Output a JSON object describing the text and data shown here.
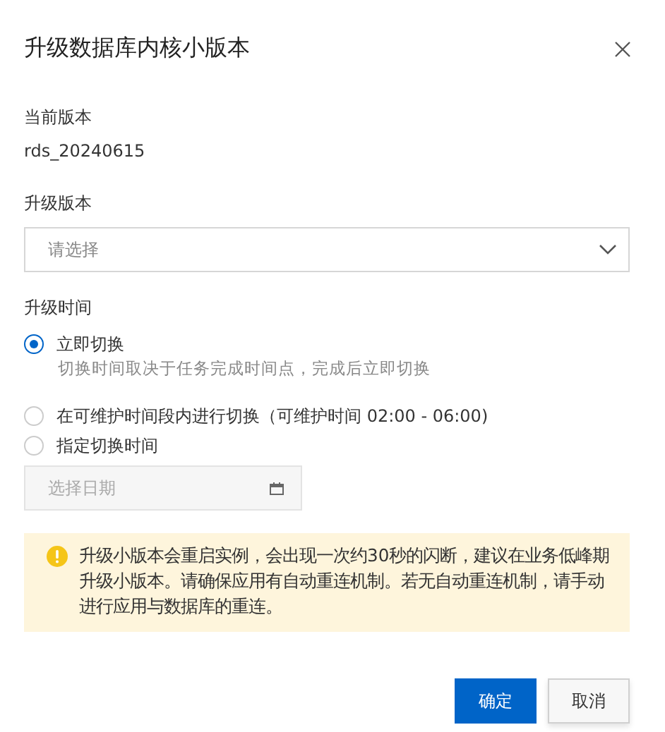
{
  "dialog": {
    "title": "升级数据库内核小版本"
  },
  "current_version": {
    "label": "当前版本",
    "value": "rds_20240615"
  },
  "target_version": {
    "label": "升级版本",
    "placeholder": "请选择"
  },
  "upgrade_time": {
    "label": "升级时间",
    "options": [
      {
        "label": "立即切换",
        "description": "切换时间取决于任务完成时间点，完成后立即切换",
        "selected": true
      },
      {
        "label": "在可维护时间段内进行切换（可维护时间 02:00 - 06:00)",
        "selected": false
      },
      {
        "label": "指定切换时间",
        "selected": false
      }
    ],
    "date_field": {
      "placeholder": "选择日期",
      "disabled": true
    }
  },
  "warning": {
    "text": "升级小版本会重启实例，会出现一次约30秒的闪断，建议在业务低峰期升级小版本。请确保应用有自动重连机制。若无自动重连机制，请手动进行应用与数据库的重连。"
  },
  "buttons": [
    {
      "label": "确定",
      "kind": "primary"
    },
    {
      "label": "取消",
      "kind": "secondary"
    }
  ]
}
